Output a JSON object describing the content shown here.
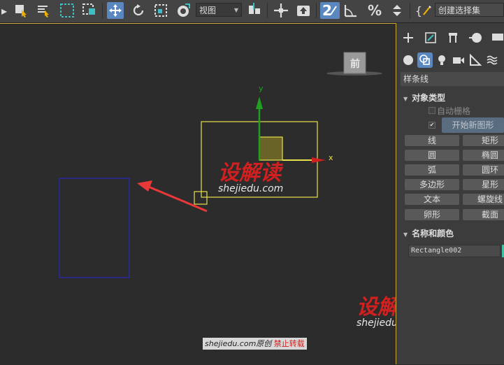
{
  "toolbar": {
    "view_dropdown": "视图",
    "snap_number": "2",
    "selection_set": "创建选择集"
  },
  "viewport": {
    "viewcube_label": "前",
    "axis_y": "y",
    "axis_x": "x"
  },
  "panel": {
    "category_dropdown": "样条线",
    "object_type": {
      "title": "对象类型",
      "auto_grid": "自动栅格",
      "start_new_shape": "开始新图形",
      "buttons": [
        "线",
        "矩形",
        "圆",
        "椭圆",
        "弧",
        "圆环",
        "多边形",
        "星形",
        "文本",
        "螺旋线",
        "卵形",
        "截面"
      ]
    },
    "name_color": {
      "title": "名称和颜色",
      "name_value": "Rectangle002"
    }
  },
  "watermarks": {
    "cn": "设解读",
    "url": "shejiedu.com",
    "footer_source": "shejiedu.com原创",
    "footer_forbid": "禁止转载"
  },
  "colors": {
    "accent": "#5b87c0",
    "selection": "#e6e04a",
    "rectangle": "#2a2aa8",
    "axis_y": "#1fa01f",
    "axis_x": "#d02020",
    "watermark": "#d02020"
  }
}
